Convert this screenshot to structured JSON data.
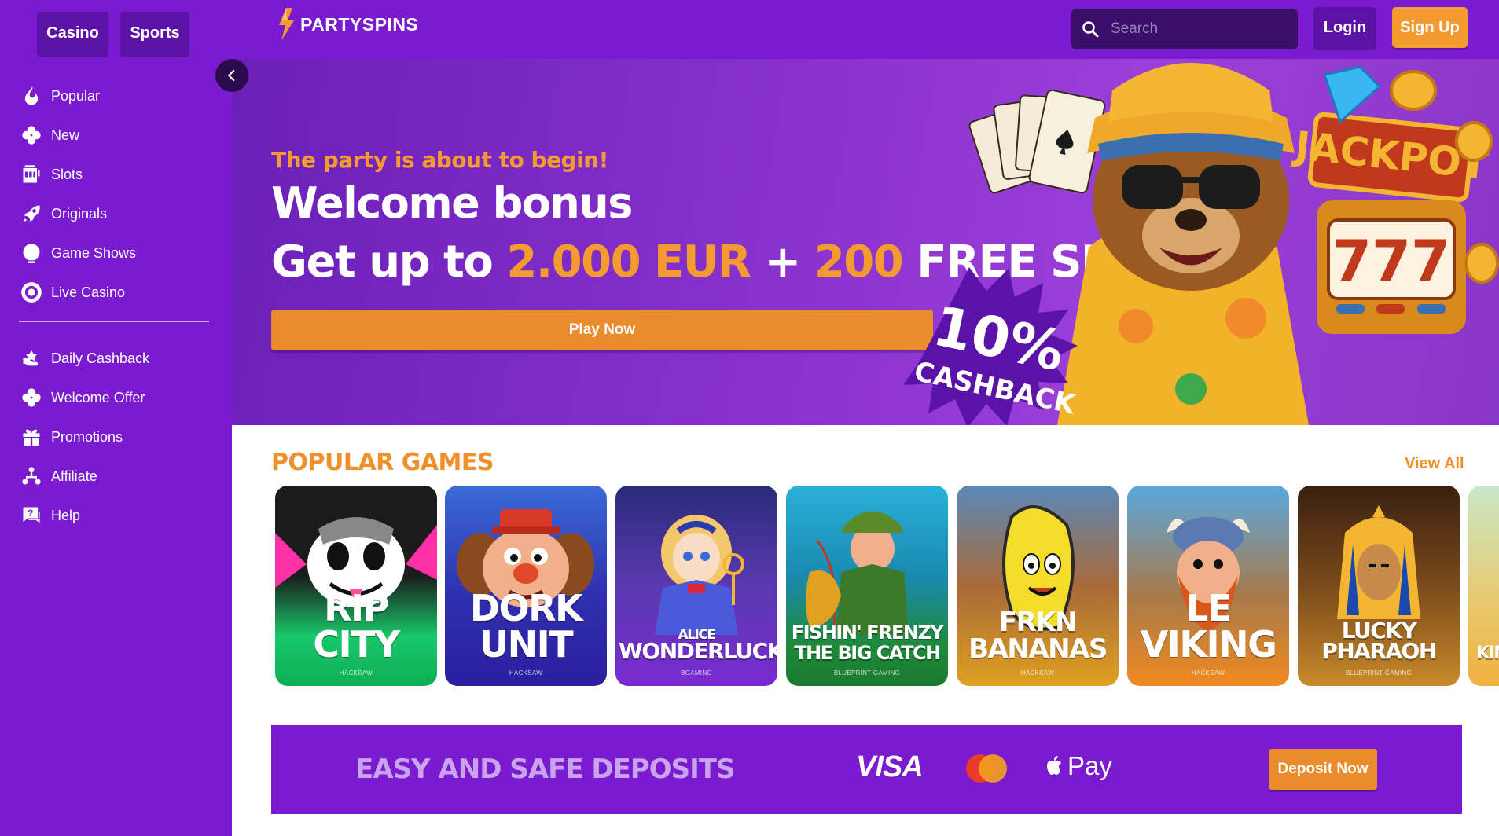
{
  "sidebar": {
    "mode_tabs": [
      {
        "label": "Casino"
      },
      {
        "label": "Sports"
      }
    ],
    "nav_primary": [
      {
        "label": "Popular",
        "icon": "flame-icon"
      },
      {
        "label": "New",
        "icon": "clover-icon"
      },
      {
        "label": "Slots",
        "icon": "slot-machine-icon"
      },
      {
        "label": "Originals",
        "icon": "rocket-icon"
      },
      {
        "label": "Game Shows",
        "icon": "prize-wheel-icon"
      },
      {
        "label": "Live Casino",
        "icon": "poker-chip-icon"
      }
    ],
    "nav_secondary": [
      {
        "label": "Daily Cashback",
        "icon": "cashback-hand-icon"
      },
      {
        "label": "Welcome Offer",
        "icon": "clover-icon"
      },
      {
        "label": "Promotions",
        "icon": "gift-icon"
      },
      {
        "label": "Affiliate",
        "icon": "network-icon"
      },
      {
        "label": "Help",
        "icon": "help-chat-icon"
      }
    ]
  },
  "header": {
    "logo_text": "PARTYSPINS",
    "search_placeholder": "Search",
    "login_label": "Login",
    "signup_label": "Sign Up"
  },
  "hero": {
    "tagline": "The party is about to begin!",
    "title": "Welcome bonus",
    "offer_prefix": "Get up to ",
    "offer_amount": "2.000 EUR",
    "offer_plus": " + ",
    "offer_spins": "200",
    "offer_suffix": " FREE SPINS",
    "cta_label": "Play Now",
    "badge_percent": "10%",
    "badge_text": "CASHBACK",
    "jackpot_text": "JACKPOT",
    "reel_digits": "777"
  },
  "popular": {
    "title": "POPULAR GAMES",
    "view_all": "View All",
    "games": [
      {
        "name": "RIP CITY",
        "provider": "HACKSAW"
      },
      {
        "name": "DORK UNIT",
        "provider": "HACKSAW"
      },
      {
        "name_line1": "ALICE",
        "name_line2": "WONDERLUCK",
        "provider": "BGAMING"
      },
      {
        "name_line1": "FISHIN' FRENZY",
        "name_line2": "THE BIG CATCH",
        "provider": "BLUEPRINT GAMING"
      },
      {
        "name": "FRKN BANANAS",
        "provider": "HACKSAW"
      },
      {
        "name": "LE VIKING",
        "provider": "HACKSAW"
      },
      {
        "name_line1": "LUCKY",
        "name_line2": "PHARAOH",
        "provider": "BLUEPRINT GAMING"
      },
      {
        "name": "KIN"
      }
    ]
  },
  "deposits": {
    "title": "EASY AND SAFE DEPOSITS",
    "visa_label": "VISA",
    "apple_pay_label": "Pay",
    "cta_label": "Deposit Now"
  },
  "colors": {
    "brand_purple": "#7a1bd0",
    "dark_purple": "#5c12a6",
    "accent_orange": "#f39a30"
  }
}
